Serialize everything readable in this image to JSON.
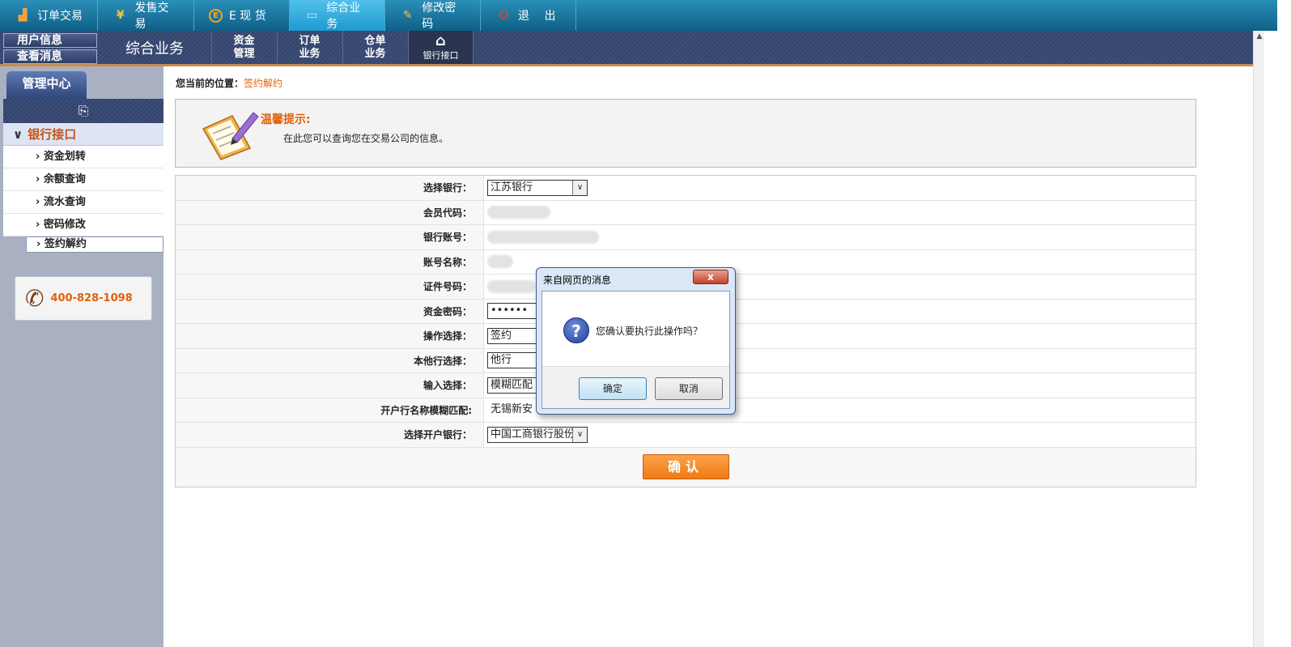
{
  "top_nav": [
    {
      "label": "订单交易",
      "icon": "chart-icon"
    },
    {
      "label": "发售交易",
      "icon": "yen-icon"
    },
    {
      "label": "E 现 货",
      "icon": "e-coin-icon"
    },
    {
      "label": "综合业务",
      "icon": "monitor-icon",
      "active": true
    },
    {
      "label": "修改密码",
      "icon": "pen-icon"
    },
    {
      "label": "退　 出",
      "icon": "power-icon"
    }
  ],
  "sub_bar": {
    "user_info": "用户信息",
    "view_messages": "查看消息",
    "title": "综合业务",
    "tabs": [
      {
        "line1": "资金",
        "line2": "管理"
      },
      {
        "line1": "订单",
        "line2": "业务"
      },
      {
        "line1": "仓单",
        "line2": "业务"
      },
      {
        "label": "银行接口",
        "active": true
      }
    ]
  },
  "sidebar": {
    "tab": "管理中心",
    "section": "银行接口",
    "items": [
      "资金划转",
      "余额查询",
      "流水查询",
      "密码修改",
      "签约解约"
    ],
    "selected": "签约解约",
    "phone": "400-828-1098"
  },
  "breadcrumb": {
    "label": "您当前的位置：",
    "current": "签约解约"
  },
  "tip": {
    "title": "温馨提示:",
    "text": "在此您可以查询您在交易公司的信息。"
  },
  "form": {
    "rows": [
      {
        "label": "选择银行：",
        "value": "江苏银行",
        "type": "select"
      },
      {
        "label": "会员代码：",
        "value": "",
        "type": "blurred"
      },
      {
        "label": "银行账号：",
        "value": "",
        "type": "blurred"
      },
      {
        "label": "账号名称：",
        "value": "",
        "type": "blurred"
      },
      {
        "label": "证件号码：",
        "value": "",
        "type": "blurred"
      },
      {
        "label": "资金密码：",
        "value": "••••••",
        "type": "password"
      },
      {
        "label": "操作选择：",
        "value": "签约",
        "type": "select"
      },
      {
        "label": "本他行选择：",
        "value": "他行",
        "type": "select"
      },
      {
        "label": "输入选择：",
        "value": "模糊匹配",
        "type": "select"
      },
      {
        "label": "开户行名称模糊匹配:",
        "value": "无锡新安",
        "type": "input"
      },
      {
        "label": "选择开户银行：",
        "value": "中国工商银行股份",
        "type": "select"
      }
    ],
    "submit": "确认"
  },
  "dialog": {
    "title": "来自网页的消息",
    "close": "x",
    "message": "您确认要执行此操作吗？",
    "ok": "确定",
    "cancel": "取消"
  }
}
